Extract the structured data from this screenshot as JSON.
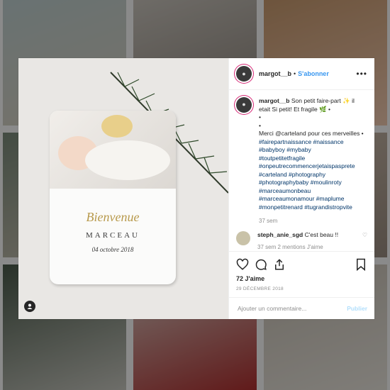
{
  "post": {
    "username": "margot__b",
    "follow_label": "S'abonner",
    "more_label": "•••",
    "caption_lines": [
      "Son petit faire-part ✨ il etait Si petit! Et fragile 🌿 •",
      "•",
      "•",
      "Merci @carteland pour ces merveilles •"
    ],
    "hashtags": [
      "#fairepartnaissance #naissance",
      "#babyboy #mybaby",
      "#toutpetitetfragile",
      "#onpeutrecommencerjetaispasprete",
      "#carteland #photography",
      "#photographybaby #moulinroty",
      "#marceaumonbeau",
      "#marceaumonamour #maplume",
      "#monpetitrenard #tugrandistropvite"
    ],
    "caption_age": "37 sem",
    "comment": {
      "user": "steph_anie_sgd",
      "text": "C'est beau !!",
      "age": "37 sem",
      "extra": "2 mentions J'aime"
    },
    "likes": "72 J'aime",
    "date": "29 DÉCEMBRE 2018",
    "comment_placeholder": "Ajouter un commentaire...",
    "publish_label": "Publier"
  },
  "card": {
    "title": "Bienvenue",
    "name": "MARCEAU",
    "date": "04 octobre 2018"
  },
  "colors": {
    "link": "#003569",
    "follow": "#3897f0",
    "publish_disabled": "#b2dffc"
  },
  "icons": [
    "heart-icon",
    "comment-icon",
    "share-icon",
    "bookmark-icon",
    "user-tag-icon"
  ]
}
